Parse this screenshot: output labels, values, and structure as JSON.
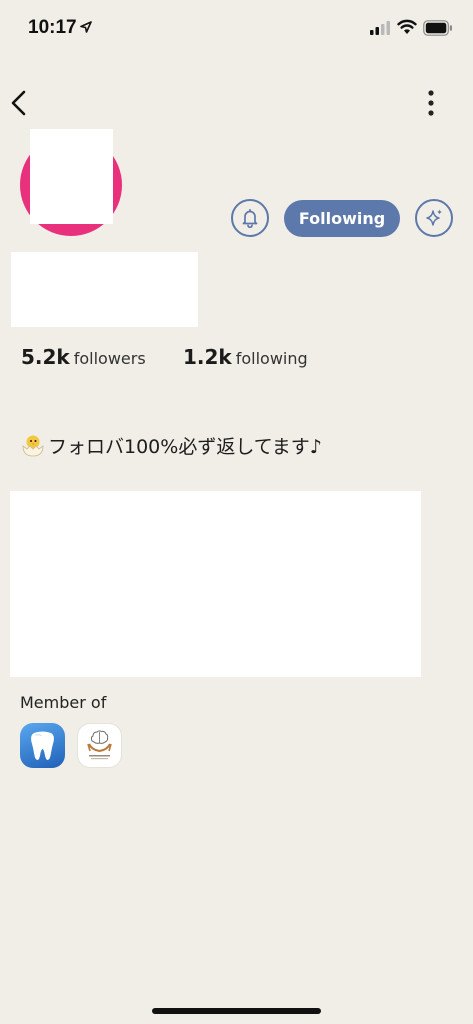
{
  "status_bar": {
    "time": "10:17",
    "icons": [
      "location-arrow-icon",
      "cellular-signal-icon",
      "wifi-icon",
      "battery-icon"
    ]
  },
  "nav": {
    "back_icon": "chevron-left-icon",
    "more_icon": "vertical-ellipsis-icon"
  },
  "profile": {
    "avatar_color": "#e8307d",
    "actions": {
      "notify_icon": "bell-icon",
      "follow_label": "Following",
      "follow_color": "#5d78aa",
      "sparkle_icon": "sparkle-icon"
    },
    "stats": {
      "followers_count": "5.2k",
      "followers_label": "followers",
      "following_count": "1.2k",
      "following_label": "following"
    },
    "bio": {
      "emoji_icon": "hatching-chick-icon",
      "text": "フォロバ100%必ず返してます♪"
    }
  },
  "member_of": {
    "label": "Member of",
    "clubs": [
      {
        "icon": "tooth-icon",
        "bg": "#3a86d8"
      },
      {
        "icon": "brain-hands-icon",
        "bg": "#ffffff"
      }
    ]
  },
  "colors": {
    "background": "#f1eee7",
    "accent": "#5d78aa"
  }
}
